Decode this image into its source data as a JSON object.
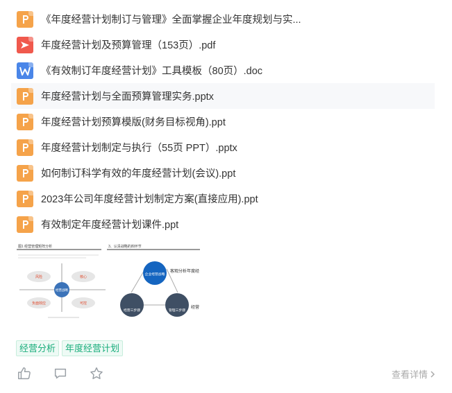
{
  "files": [
    {
      "type": "ppt",
      "icon": "ppt-file-icon",
      "name": "《年度经营计划制订与管理》全面掌握企业年度规划与实..."
    },
    {
      "type": "pdf",
      "icon": "pdf-file-icon",
      "name": "年度经营计划及预算管理（153页）.pdf"
    },
    {
      "type": "doc",
      "icon": "doc-file-icon",
      "name": "《有效制订年度经营计划》工具模板（80页）.doc"
    },
    {
      "type": "ppt",
      "icon": "ppt-file-icon",
      "name": "年度经营计划与全面预算管理实务.pptx",
      "highlighted": true
    },
    {
      "type": "ppt",
      "icon": "ppt-file-icon",
      "name": "年度经营计划预算模版(财务目标视角).ppt"
    },
    {
      "type": "ppt",
      "icon": "ppt-file-icon",
      "name": "年度经营计划制定与执行（55页 PPT）.pptx"
    },
    {
      "type": "ppt",
      "icon": "ppt-file-icon",
      "name": "如何制订科学有效的年度经营计划(会议).ppt"
    },
    {
      "type": "ppt",
      "icon": "ppt-file-icon",
      "name": "2023年公司年度经营计划制定方案(直接应用).ppt"
    },
    {
      "type": "ppt",
      "icon": "ppt-file-icon",
      "name": "有效制定年度经营计划课件.ppt"
    }
  ],
  "thumbnail": {
    "left_title": "图1 经营管理矩阵分析",
    "right_title": "3、认清战略的四环节",
    "center_label": "经营战略",
    "node_top": "企业经营战略",
    "node_left": "经营三步骤",
    "node_right": "管理三步骤",
    "side_text_1": "客观分析年度经",
    "side_text_2": "经营",
    "ellipses": [
      "风险",
      "核心",
      "负面效应",
      "可控"
    ]
  },
  "tags": [
    "经营分析",
    "年度经营计划"
  ],
  "actions": {
    "like_icon": "thumbs-up-icon",
    "comment_icon": "comment-icon",
    "favorite_icon": "star-icon"
  },
  "details_label": "查看详情",
  "colors": {
    "ppt": "#f5a34a",
    "pdf": "#f0594d",
    "doc": "#4a86e8",
    "tag": "#1aae7c"
  }
}
